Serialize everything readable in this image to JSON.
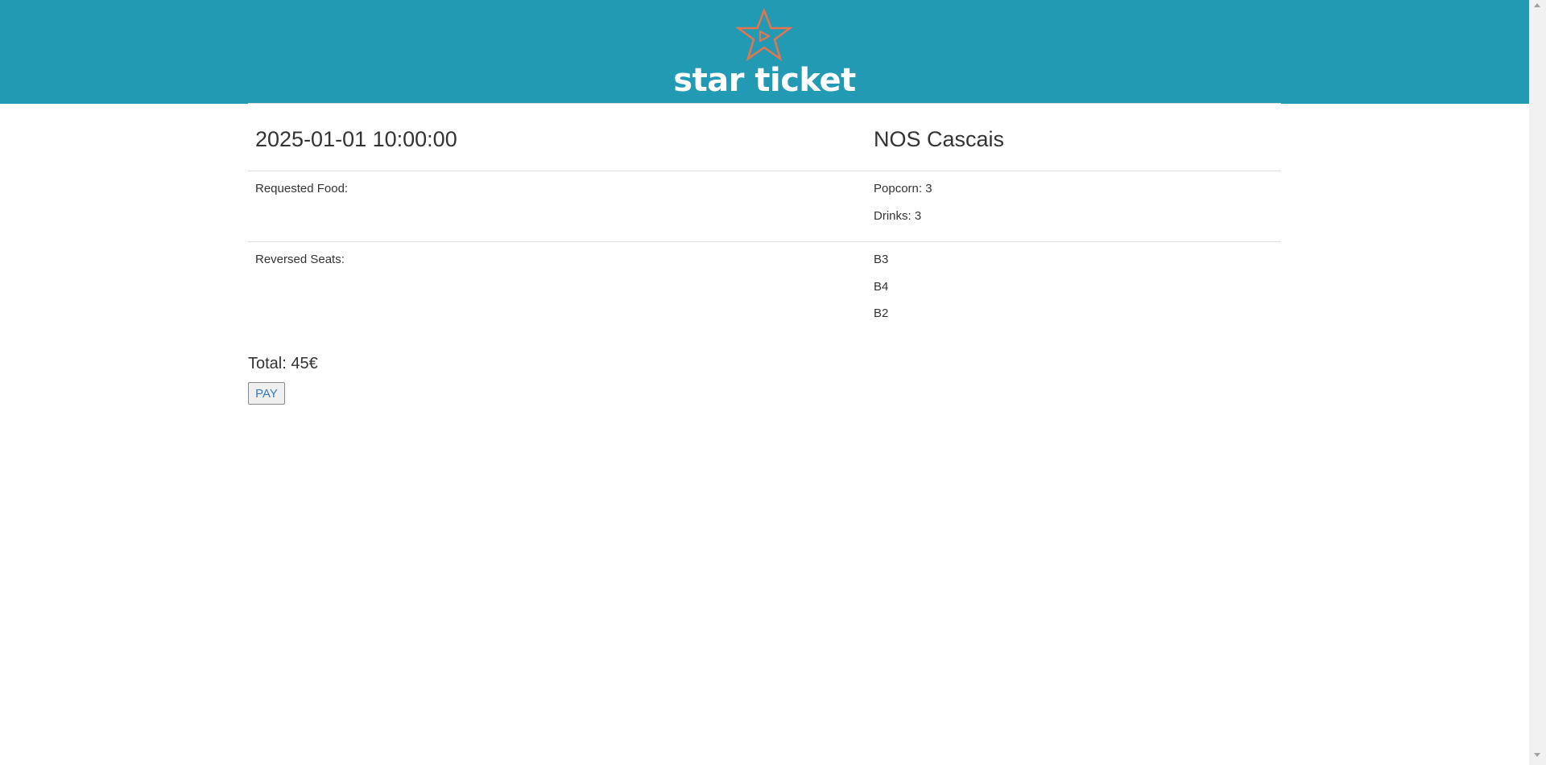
{
  "brand": {
    "name": "star ticket",
    "header_color": "#239ab3",
    "logo_color": "#e8744c",
    "logo_icon": "star-play-icon"
  },
  "session": {
    "datetime": "2025-01-01 10:00:00",
    "cinema": "NOS Cascais"
  },
  "food": {
    "label": "Requested Food:",
    "items": [
      "Popcorn: 3",
      "Drinks: 3"
    ]
  },
  "seats": {
    "label": "Reversed Seats:",
    "items": [
      "B3",
      "B4",
      "B2"
    ]
  },
  "summary": {
    "total": "Total: 45€",
    "pay_label": "PAY"
  }
}
